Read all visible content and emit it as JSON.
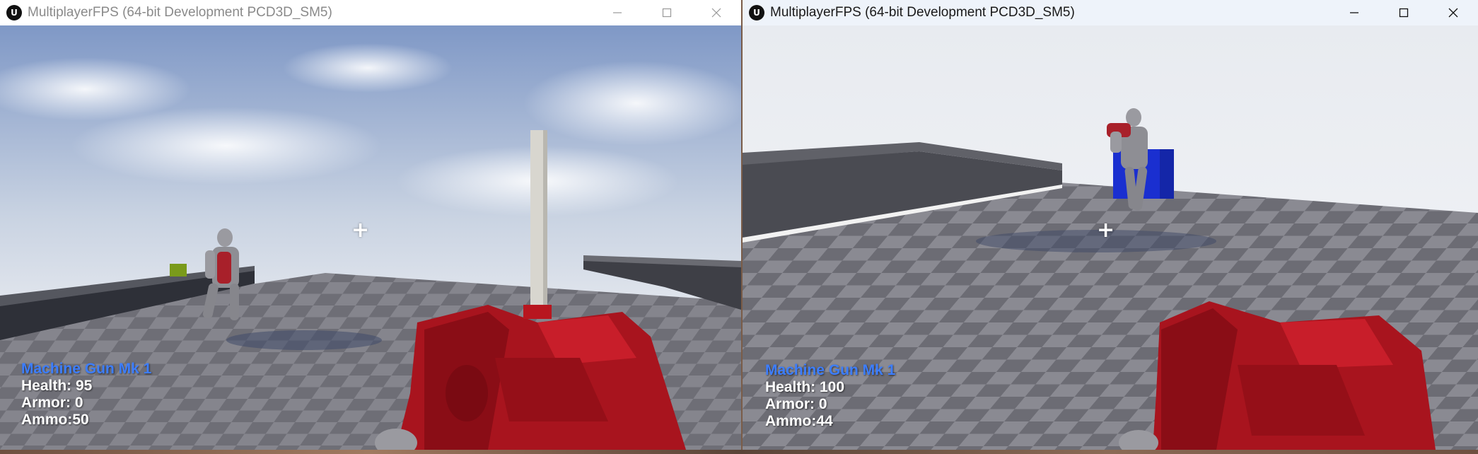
{
  "windows": [
    {
      "title": "MultiplayerFPS (64-bit Development PCD3D_SM5)",
      "hud": {
        "weapon": "Machine Gun Mk 1",
        "health": "Health: 95",
        "armor": "Armor: 0",
        "ammo": "Ammo:50"
      }
    },
    {
      "title": "MultiplayerFPS (64-bit Development PCD3D_SM5)",
      "hud": {
        "weapon": "Machine Gun Mk 1",
        "health": "Health: 100",
        "armor": "Armor: 0",
        "ammo": "Ammo:44"
      }
    }
  ],
  "icons": {
    "app": "unreal-engine-logo-icon",
    "minimize": "minimize-icon",
    "maximize": "maximize-icon",
    "close": "close-icon",
    "crosshair": "crosshair-icon"
  },
  "colors": {
    "hud_weapon": "#3d7eff",
    "weapon_red": "#a8141e",
    "floor_dark": "#5a5a60",
    "floor_light": "#7c7c84",
    "sky": "#b9c7dc",
    "blue_cube": "#1a2fd0",
    "green_cube": "#7a9a1a"
  }
}
